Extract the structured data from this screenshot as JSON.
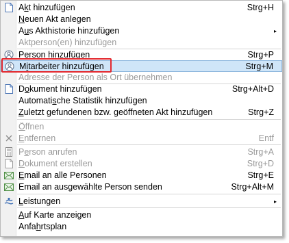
{
  "menu": {
    "items": [
      {
        "pre": "A",
        "key": "k",
        "post": "t hinzufügen",
        "shortcut": "Strg+H",
        "icon": "document-icon"
      },
      {
        "pre": "",
        "key": "N",
        "post": "euen Akt anlegen",
        "shortcut": ""
      },
      {
        "pre": "A",
        "key": "u",
        "post": "s Akthistorie hinzufügen",
        "shortcut": "",
        "submenu": "▸"
      },
      {
        "pre": "Aktperson(en) hinzufügen",
        "key": "",
        "post": "",
        "shortcut": "",
        "disabled": true
      },
      {
        "pre": "",
        "key": "P",
        "post": "erson hinzufügen",
        "shortcut": "Strg+P",
        "icon": "person-icon"
      },
      {
        "pre": "M",
        "key": "i",
        "post": "tarbeiter hinzufügen",
        "shortcut": "Strg+M",
        "icon": "person-icon",
        "highlighted": true
      },
      {
        "pre": "Adresse der Person als Ort übernehmen",
        "key": "",
        "post": "",
        "shortcut": "",
        "disabled": true
      },
      {
        "pre": "D",
        "key": "o",
        "post": "kument hinzufügen",
        "shortcut": "Strg+Alt+D",
        "icon": "document-icon"
      },
      {
        "pre": "Automati",
        "key": "s",
        "post": "che Statistik hinzufügen",
        "shortcut": ""
      },
      {
        "pre": "",
        "key": "Z",
        "post": "uletzt gefundenen bzw. geöffneten Akt hinzufügen",
        "shortcut": "Strg+Z"
      },
      {
        "pre": "",
        "key": "Ö",
        "post": "ffnen",
        "shortcut": "",
        "disabled": true
      },
      {
        "pre": "",
        "key": "E",
        "post": "ntfernen",
        "shortcut": "Entf",
        "disabled": true,
        "icon": "close-icon"
      },
      {
        "pre": "P",
        "key": "e",
        "post": "rson anrufen",
        "shortcut": "Strg+A",
        "disabled": true,
        "icon": "phone-icon"
      },
      {
        "pre": "",
        "key": "D",
        "post": "okument erstellen",
        "shortcut": "Strg+D",
        "disabled": true,
        "icon": "document-icon"
      },
      {
        "pre": "",
        "key": "E",
        "post": "mail an alle Personen",
        "shortcut": "Strg+E",
        "icon": "email-icon"
      },
      {
        "pre": "Email an ausgewählte Person senden",
        "key": "",
        "post": "",
        "shortcut": "Strg+Alt+M",
        "icon": "email-icon"
      },
      {
        "pre": "",
        "key": "L",
        "post": "eistungen",
        "shortcut": "",
        "submenu": "▸",
        "icon": "services-icon"
      },
      {
        "pre": "",
        "key": "A",
        "post": "uf Karte anzeigen",
        "shortcut": ""
      },
      {
        "pre": "Anfa",
        "key": "h",
        "post": "rtsplan",
        "shortcut": ""
      }
    ]
  },
  "colors": {
    "highlight": "#cfe5f8",
    "highlight_border": "#8fb8de",
    "annotation_box": "#e3272d",
    "disabled_text": "#9a9a9a"
  }
}
